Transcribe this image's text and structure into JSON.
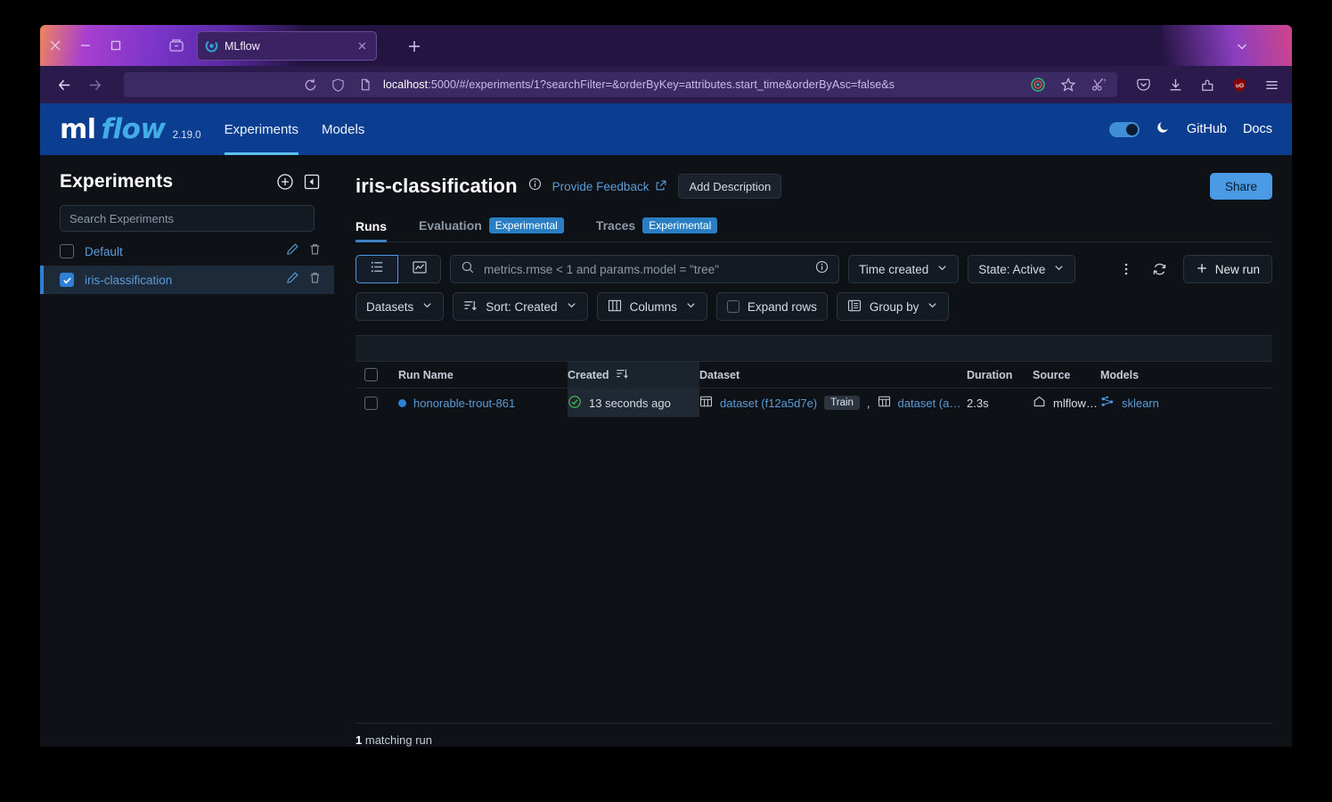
{
  "browser": {
    "tab": {
      "title": "MLflow",
      "favicon": "mlflow-favicon"
    },
    "url_host": "localhost",
    "url_rest": ":5000/#/experiments/1?searchFilter=&orderByKey=attributes.start_time&orderByAsc=false&s",
    "icons": {
      "back": "back-arrow-icon",
      "forward": "forward-arrow-icon",
      "reload": "reload-icon",
      "shield": "shield-icon",
      "page": "page-icon",
      "tracking": "tracking-protection-icon",
      "bookmark": "bookmark-star-icon",
      "screenshot": "screenshot-scissors-icon",
      "pocket": "pocket-icon",
      "downloads": "downloads-icon",
      "extensions": "extensions-icon",
      "ublock": "ublock-origin-icon",
      "menu": "hamburger-menu-icon"
    }
  },
  "header": {
    "logo_ml": "ml",
    "logo_flow": "flow",
    "version": "2.19.0",
    "nav": [
      {
        "label": "Experiments",
        "active": true
      },
      {
        "label": "Models",
        "active": false
      }
    ],
    "dark_mode_on": true,
    "links": [
      {
        "label": "GitHub"
      },
      {
        "label": "Docs"
      }
    ]
  },
  "sidebar": {
    "title": "Experiments",
    "search_placeholder": "Search Experiments",
    "experiments": [
      {
        "name": "Default",
        "selected": false
      },
      {
        "name": "iris-classification",
        "selected": true
      }
    ]
  },
  "main": {
    "page_title": "iris-classification",
    "feedback_label": "Provide Feedback",
    "add_description_label": "Add Description",
    "share_label": "Share",
    "tabs": [
      {
        "label": "Runs",
        "badge": "",
        "active": true
      },
      {
        "label": "Evaluation",
        "badge": "Experimental",
        "active": false
      },
      {
        "label": "Traces",
        "badge": "Experimental",
        "active": false
      }
    ],
    "toolbar": {
      "search_placeholder": "metrics.rmse < 1 and params.model = \"tree\"",
      "time_created_label": "Time created",
      "state_label": "State: Active",
      "new_run_label": "New run"
    },
    "toolbar2": {
      "datasets_label": "Datasets",
      "sort_label": "Sort: Created",
      "columns_label": "Columns",
      "expand_rows_label": "Expand rows",
      "group_by_label": "Group by"
    },
    "table": {
      "columns": [
        "Run Name",
        "Created",
        "Dataset",
        "Duration",
        "Source",
        "Models"
      ],
      "rows": [
        {
          "run_name": "honorable-trout-861",
          "created": "13 seconds ago",
          "dataset_1": "dataset (f12a5d7e)",
          "dataset_tag": "Train",
          "dataset_sep": ",",
          "dataset_2": "dataset (a…",
          "duration": "2.3s",
          "source": "mlflow_…",
          "models": "sklearn"
        }
      ]
    },
    "footer_count": "1",
    "footer_label": "matching run"
  }
}
